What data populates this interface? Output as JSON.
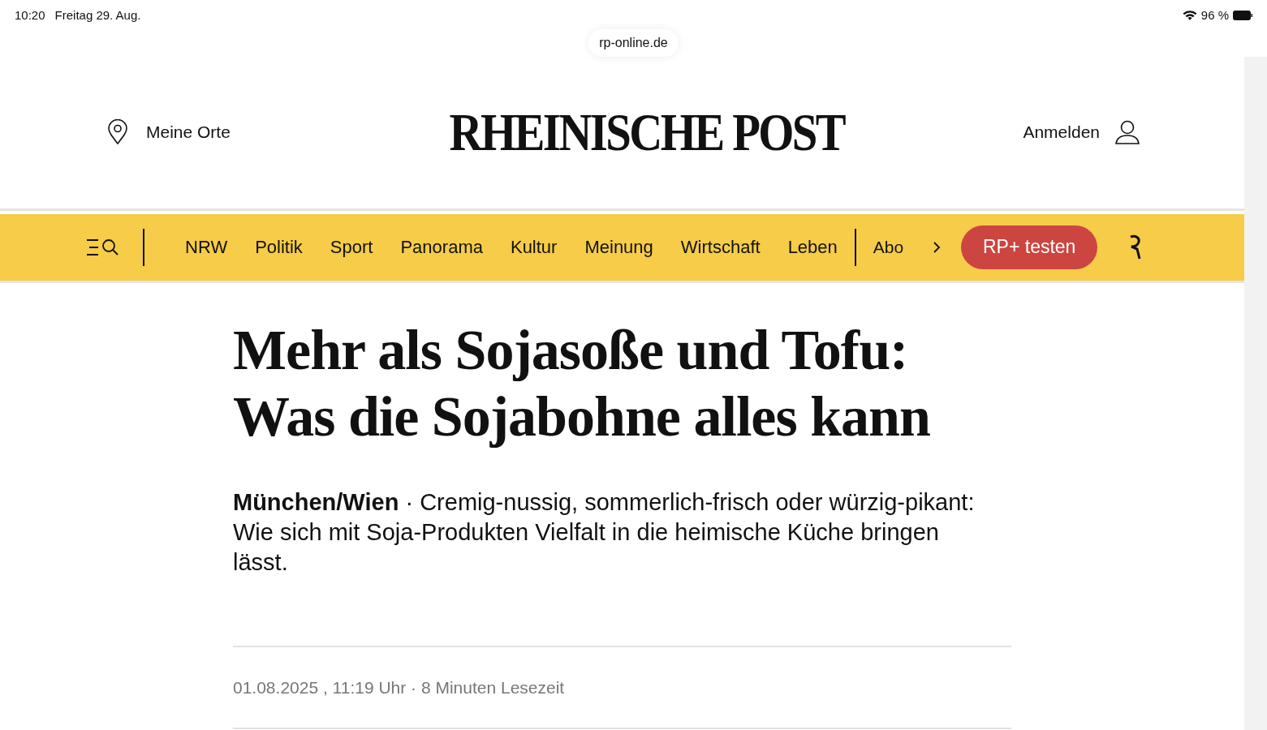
{
  "status_bar": {
    "time": "10:20",
    "date": "Freitag 29. Aug.",
    "battery": "96 %"
  },
  "address_bar": {
    "url": "rp-online.de"
  },
  "header": {
    "places": "Meine Orte",
    "logo": "RHEINISCHE POST",
    "login": "Anmelden"
  },
  "nav": {
    "items": [
      "NRW",
      "Politik",
      "Sport",
      "Panorama",
      "Kultur",
      "Meinung",
      "Wirtschaft",
      "Leben"
    ],
    "more": "Abo",
    "cta": "RP+ testen"
  },
  "article": {
    "headline_lines": [
      "Mehr als Sojasoße und Tofu:",
      "Was die Sojabohne alles kann"
    ],
    "dateline": "München/Wien",
    "separator": "·",
    "teaser": "Cremig-nussig, sommerlich-frisch oder würzig-pikant: Wie sich mit Soja-Produkten Vielfalt in die heimische Küche bringen lässt.",
    "meta": "01.08.2025 , 11:19 Uhr · 8 Minuten Lesezeit"
  }
}
